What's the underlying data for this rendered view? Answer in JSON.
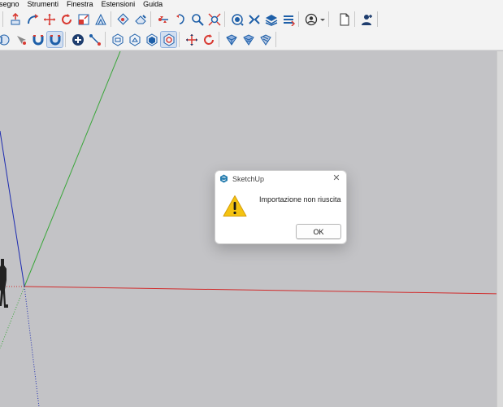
{
  "menubar": {
    "items": [
      "isegno",
      "Strumenti",
      "Finestra",
      "Estensioni",
      "Guida"
    ]
  },
  "toolbars": {
    "row1_icons": [
      "push-pull-icon",
      "follow-me-icon",
      "move-icon",
      "rotate-icon",
      "scale-icon",
      "section-plane-icon",
      "paint-bucket-icon",
      "eraser-icon",
      "flip-icon",
      "orbit-icon",
      "zoom-icon",
      "zoom-extents-icon",
      "dimension-icon",
      "sandbox-icon",
      "layers-icon",
      "model-info-icon",
      "user-icon",
      "new-file-icon",
      "account-icon"
    ],
    "row2_icons": [
      "solid-tools-icon",
      "select-icon",
      "magnet-icon",
      "add-icon",
      "tape-measure-icon",
      "iso-view-icon",
      "top-view-icon",
      "front-view-icon",
      "right-view-icon",
      "back-view-icon",
      "move-tool-icon",
      "rotate-tool-icon",
      "shaded-icon",
      "textured-icon",
      "monochrome-icon"
    ]
  },
  "colors": {
    "viewport_bg": "#c3c3c6",
    "axis_red": "#d12b2b",
    "axis_green": "#3aa63a",
    "axis_blue": "#1d2bb0",
    "icon_blue": "#1e5fa8",
    "icon_red": "#d83a32",
    "warning_yellow": "#f4c311"
  },
  "dialog": {
    "title": "SketchUp",
    "message": "Importazione non riuscita",
    "ok_label": "OK",
    "close_glyph": "✕"
  }
}
